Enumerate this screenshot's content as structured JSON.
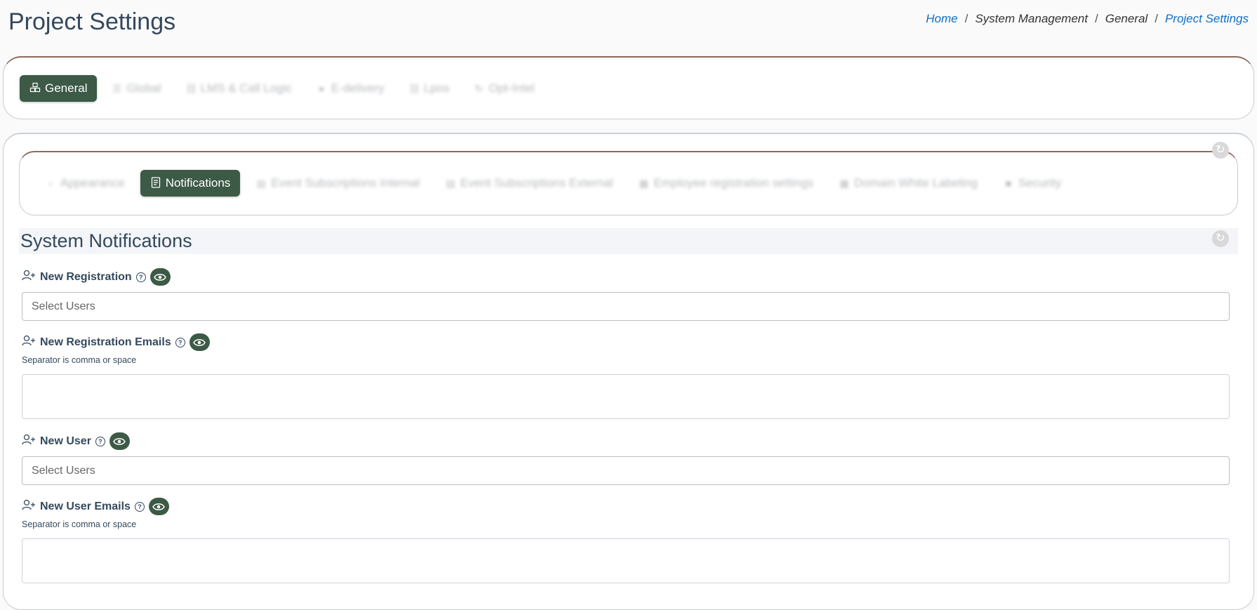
{
  "page": {
    "title": "Project Settings"
  },
  "breadcrumb": [
    "Home",
    "System Management",
    "General",
    "Project Settings"
  ],
  "main_tabs": [
    {
      "label": "General",
      "icon": "boxes-icon",
      "active": true
    },
    {
      "label": "Global",
      "icon": "list-icon",
      "active": false
    },
    {
      "label": "LMS & Call Logic",
      "icon": "link-icon",
      "active": false
    },
    {
      "label": "E-delivery",
      "icon": "globe-icon",
      "active": false
    },
    {
      "label": "Lpos",
      "icon": "link-icon",
      "active": false
    },
    {
      "label": "Opt-Intel",
      "icon": "refresh-icon",
      "active": false
    }
  ],
  "sub_tabs": [
    {
      "label": "Appearance",
      "icon": "chevron-left-icon",
      "active": false
    },
    {
      "label": "Notifications",
      "icon": "document-icon",
      "active": true
    },
    {
      "label": "Event Subscriptions Internal",
      "icon": "list-icon",
      "active": false
    },
    {
      "label": "Event Subscriptions External",
      "icon": "list-icon",
      "active": false
    },
    {
      "label": "Employee registration settings",
      "icon": "grid-icon",
      "active": false
    },
    {
      "label": "Domain White Labeling",
      "icon": "grid-icon",
      "active": false
    },
    {
      "label": "Security",
      "icon": "lock-icon",
      "active": false
    }
  ],
  "section": {
    "title": "System Notifications"
  },
  "fields": {
    "new_registration": {
      "label": "New Registration",
      "placeholder": "Select Users"
    },
    "new_registration_emails": {
      "label": "New Registration Emails",
      "hint": "Separator is comma or space"
    },
    "new_user": {
      "label": "New User",
      "placeholder": "Select Users"
    },
    "new_user_emails": {
      "label": "New User Emails",
      "hint": "Separator is comma or space"
    }
  },
  "colors": {
    "accent": "#3c5a46",
    "link": "#0f6fc6",
    "text": "#34495e",
    "border_accent": "#8b6a5e"
  }
}
